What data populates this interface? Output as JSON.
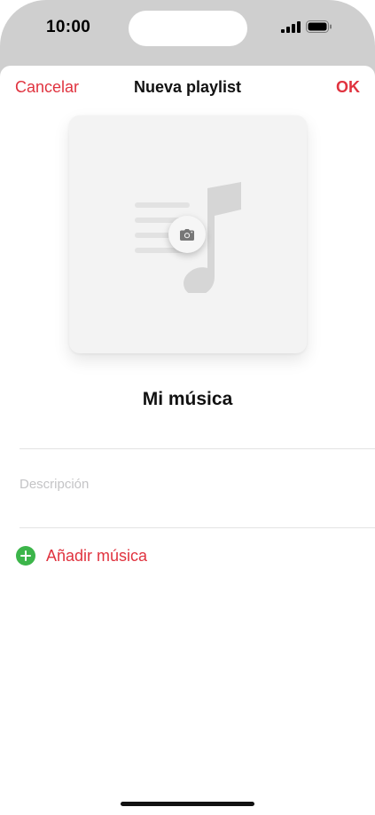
{
  "status_bar": {
    "time": "10:00"
  },
  "nav": {
    "cancel_label": "Cancelar",
    "title": "Nueva playlist",
    "ok_label": "OK"
  },
  "artwork": {
    "icon": "music-note-icon",
    "action_icon": "camera-icon"
  },
  "playlist": {
    "name": "Mi música",
    "description_placeholder": "Descripción"
  },
  "actions": {
    "add_music_label": "Añadir música",
    "add_icon": "plus-circle-icon"
  },
  "colors": {
    "accent": "#e0333f",
    "add_green": "#3cb54a"
  }
}
